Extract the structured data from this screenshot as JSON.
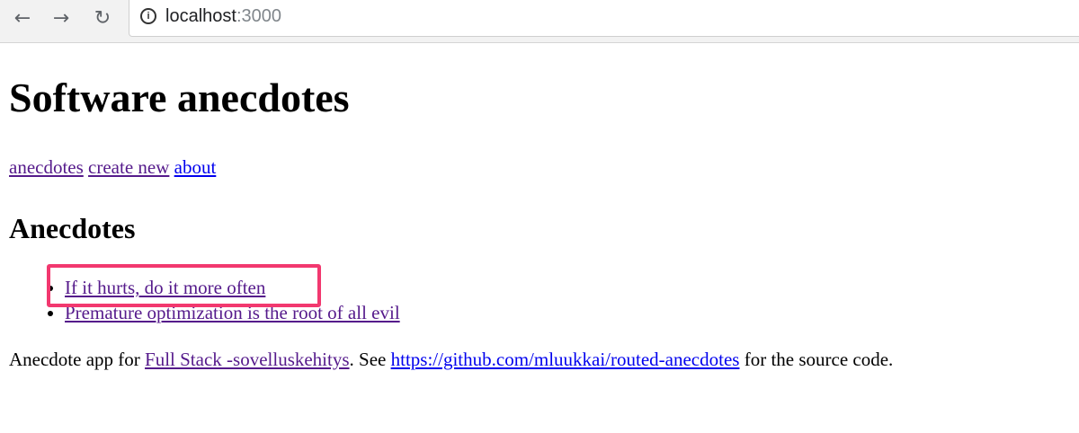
{
  "browser": {
    "back_icon": "←",
    "forward_icon": "→",
    "reload_icon": "↻",
    "info_icon": "i",
    "url_host": "localhost",
    "url_port": ":3000"
  },
  "page": {
    "title": "Software anecdotes",
    "menu": {
      "anecdotes": "anecdotes",
      "create_new": "create new",
      "about": "about"
    },
    "heading": "Anecdotes",
    "anecdotes": [
      "If it hurts, do it more often",
      "Premature optimization is the root of all evil"
    ],
    "footer": {
      "prefix": "Anecdote app for ",
      "course_link": "Full Stack -sovelluskehitys",
      "middle": ". See ",
      "repo_link": "https://github.com/mluukkai/routed-anecdotes",
      "suffix": " for the source code."
    }
  },
  "colors": {
    "link": "#0000ee",
    "visited_link": "#551a8b",
    "highlight_border": "#f2386f"
  }
}
